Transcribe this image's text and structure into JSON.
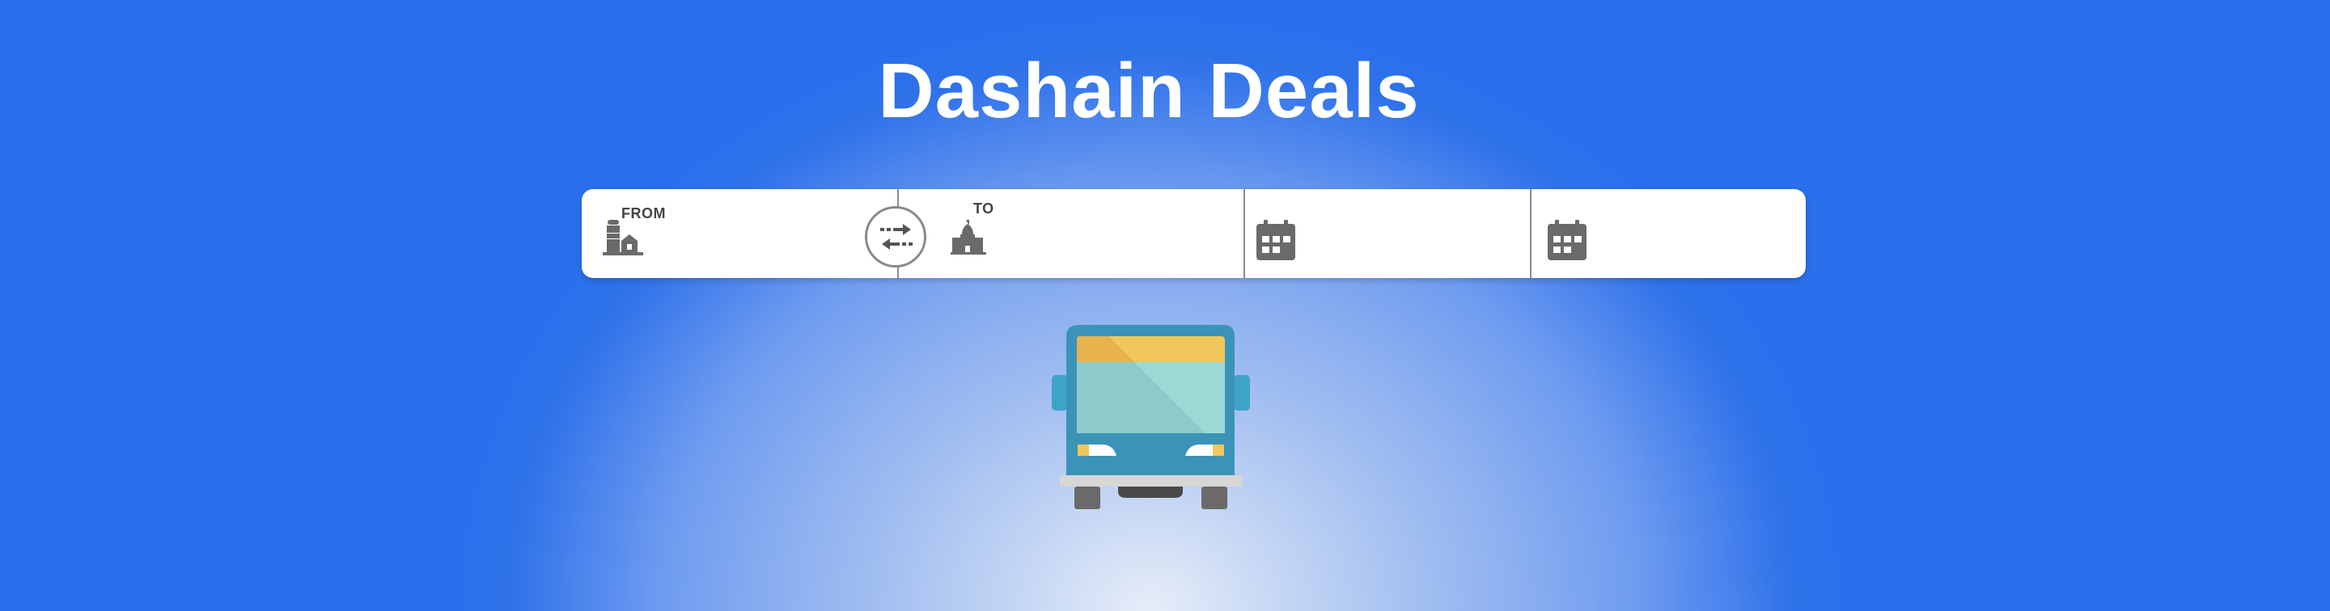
{
  "header": {
    "title": "Dashain Deals"
  },
  "search": {
    "from": {
      "label": "FROM",
      "icon": "buildings-icon"
    },
    "swap": {
      "icon": "swap-arrows-icon"
    },
    "to": {
      "label": "TO",
      "icon": "temple-icon"
    },
    "depart": {
      "icon": "calendar-icon"
    },
    "return": {
      "icon": "calendar-icon"
    }
  },
  "hero": {
    "icon": "bus-icon"
  },
  "colors": {
    "background_blue": "#2a70ec",
    "bus_body": "#3b93b8",
    "bus_window": "#9fd9d6",
    "bus_top_strip": "#f1c75b",
    "icon_gray": "#666666"
  }
}
